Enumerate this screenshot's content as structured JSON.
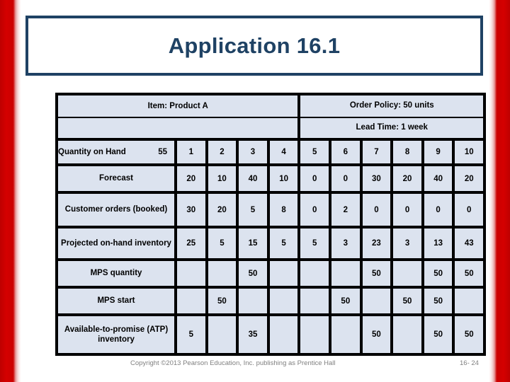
{
  "slide": {
    "title": "Application 16.1"
  },
  "mps": {
    "item_label": "Item: Product A",
    "order_policy": "Order Policy: 50 units",
    "lead_time": "Lead Time: 1 week",
    "qoh_label": "Quantity on Hand",
    "qoh_value": "55",
    "period_headers": [
      "1",
      "2",
      "3",
      "4",
      "5",
      "6",
      "7",
      "8",
      "9",
      "10"
    ],
    "rows": [
      {
        "label": "Forecast",
        "highlight": false,
        "values": [
          "20",
          "10",
          "40",
          "10",
          "0",
          "0",
          "30",
          "20",
          "40",
          "20"
        ]
      },
      {
        "label": "Customer orders (booked)",
        "highlight": false,
        "values": [
          "30",
          "20",
          "5",
          "8",
          "0",
          "2",
          "0",
          "0",
          "0",
          "0"
        ]
      },
      {
        "label": "Projected on-hand inventory",
        "highlight": true,
        "values": [
          "25",
          "5",
          "15",
          "5",
          "5",
          "3",
          "23",
          "3",
          "13",
          "43"
        ]
      },
      {
        "label": "MPS quantity",
        "highlight": true,
        "values": [
          "",
          "",
          "50",
          "",
          "",
          "",
          "50",
          "",
          "50",
          "50"
        ]
      },
      {
        "label": "MPS start",
        "highlight": true,
        "values": [
          "",
          "50",
          "",
          "",
          "",
          "50",
          "",
          "50",
          "50",
          ""
        ]
      },
      {
        "label": "Available-to-promise (ATP) inventory",
        "highlight": true,
        "values": [
          "5",
          "",
          "35",
          "",
          "",
          "",
          "50",
          "",
          "50",
          "50"
        ]
      }
    ]
  },
  "footer": {
    "copyright": "Copyright ©2013 Pearson Education, Inc. publishing as Prentice Hall",
    "page": "16- 24"
  },
  "colors": {
    "accent_navy": "#1f4264",
    "stripe_red": "#c00000",
    "cell_blue": "#dce3ef",
    "cell_yellow": "#ffff00"
  }
}
